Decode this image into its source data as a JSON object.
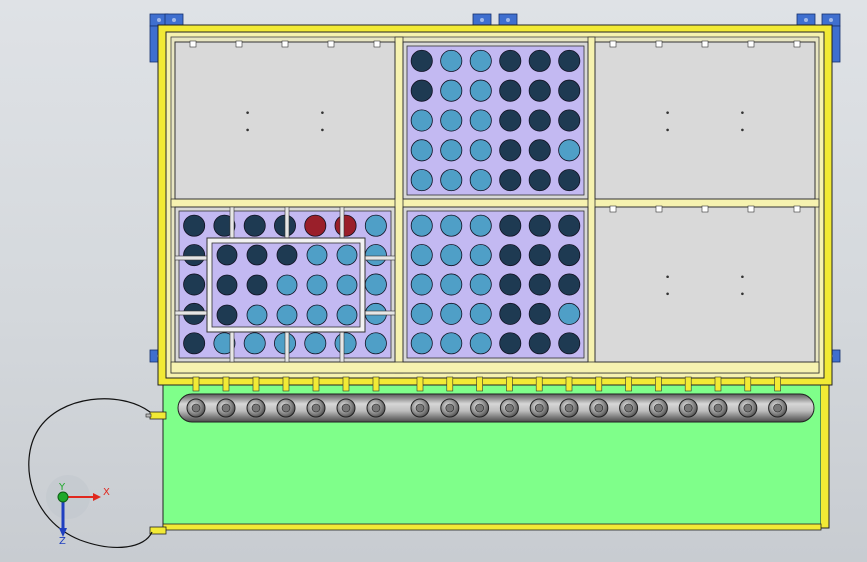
{
  "app": {
    "title": "",
    "background_color": "#d8dbe0"
  },
  "viewport": {
    "view": "top",
    "model_colors": {
      "outer_frame": "#f2ea35",
      "inner_frame": "#f6f2b0",
      "gray_panel": "#d9d9d9",
      "purple_panel": "#c3b9f2",
      "hole_light": "#4f9fc7",
      "hole_dark": "#1e3a52",
      "hole_red": "#9a1f2a",
      "tank": "#7fff8a",
      "manifold": "#a8a8a8",
      "bracket": "#3f6fcf"
    }
  },
  "model": {
    "panels": [
      {
        "name": "top-left",
        "kind": "gray"
      },
      {
        "name": "top-center",
        "kind": "perforated",
        "rows": 5,
        "cols": 6
      },
      {
        "name": "top-right",
        "kind": "gray"
      },
      {
        "name": "bottom-left",
        "kind": "perforated",
        "rows": 5,
        "cols": 7,
        "sub_panel": true
      },
      {
        "name": "bottom-center",
        "kind": "perforated",
        "rows": 5,
        "cols": 6
      },
      {
        "name": "bottom-right",
        "kind": "gray"
      }
    ],
    "manifold_valve_count": 20
  },
  "triad": {
    "x_label": "X",
    "y_label": "Y",
    "z_label": "Z",
    "x_color": "#e0281e",
    "y_color": "#1fa82a",
    "z_color": "#1f3fc0"
  }
}
